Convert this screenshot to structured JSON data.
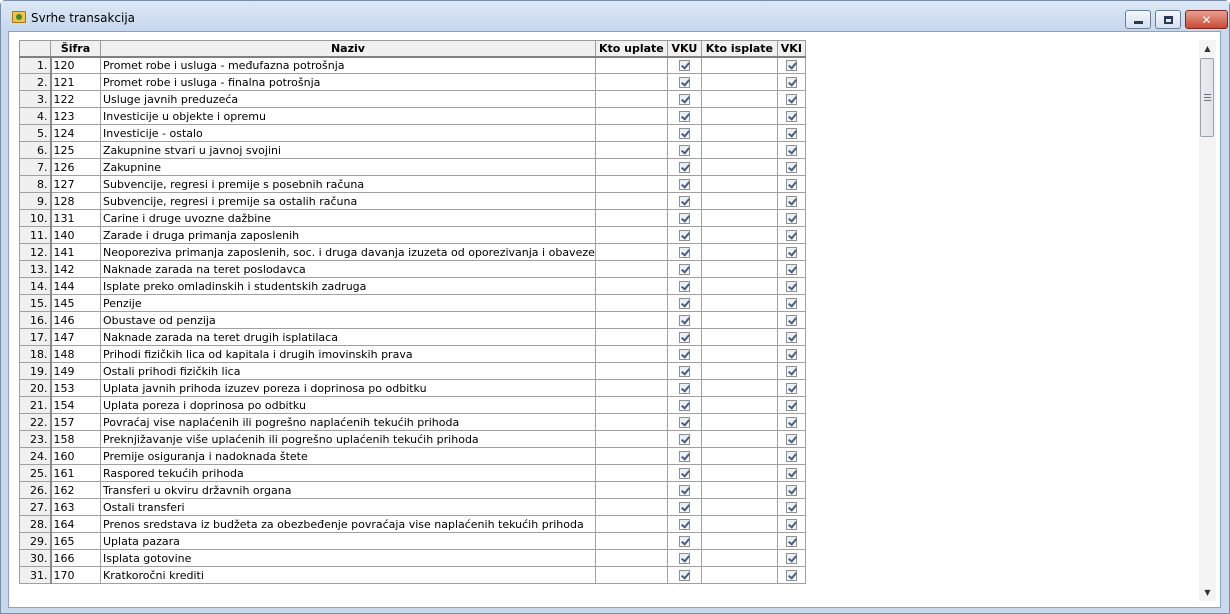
{
  "window": {
    "title": "Svrhe transakcija",
    "icon": "app-window-icon",
    "controls": {
      "minimize": "minimize-icon",
      "maximize": "maximize-icon",
      "close": "✕"
    }
  },
  "table": {
    "columns": {
      "code": "Šifra",
      "name": "Naziv",
      "kto_uplate": "Kto uplate",
      "vku": "VKU",
      "kto_isplate": "Kto isplate",
      "vki": "VKI"
    },
    "rows": [
      {
        "num": "1.",
        "code": "120",
        "name": "Promet robe i usluga - međufazna potrošnja",
        "vku": true,
        "vki": true
      },
      {
        "num": "2.",
        "code": "121",
        "name": "Promet robe i usluga - finalna potrošnja",
        "vku": true,
        "vki": true
      },
      {
        "num": "3.",
        "code": "122",
        "name": "Usluge javnih preduzeća",
        "vku": true,
        "vki": true
      },
      {
        "num": "4.",
        "code": "123",
        "name": "Investicije u objekte i opremu",
        "vku": true,
        "vki": true
      },
      {
        "num": "5.",
        "code": "124",
        "name": "Investicije - ostalo",
        "vku": true,
        "vki": true
      },
      {
        "num": "6.",
        "code": "125",
        "name": "Zakupnine stvari u javnoj svojini",
        "vku": true,
        "vki": true
      },
      {
        "num": "7.",
        "code": "126",
        "name": "Zakupnine",
        "vku": true,
        "vki": true
      },
      {
        "num": "8.",
        "code": "127",
        "name": "Subvencije, regresi i premije s posebnih računa",
        "vku": true,
        "vki": true
      },
      {
        "num": "9.",
        "code": "128",
        "name": "Subvencije, regresi i premije sa ostalih računa",
        "vku": true,
        "vki": true
      },
      {
        "num": "10.",
        "code": "131",
        "name": "Carine i druge uvozne dažbine",
        "vku": true,
        "vki": true
      },
      {
        "num": "11.",
        "code": "140",
        "name": "Zarade i druga primanja zaposlenih",
        "vku": true,
        "vki": true
      },
      {
        "num": "12.",
        "code": "141",
        "name": "Neoporeziva primanja zaposlenih, soc. i druga davanja izuzeta od oporezivanja i obaveze",
        "vku": true,
        "vki": true
      },
      {
        "num": "13.",
        "code": "142",
        "name": "Naknade zarada na teret poslodavca",
        "vku": true,
        "vki": true
      },
      {
        "num": "14.",
        "code": "144",
        "name": "Isplate preko omladinskih i studentskih zadruga",
        "vku": true,
        "vki": true
      },
      {
        "num": "15.",
        "code": "145",
        "name": "Penzije",
        "vku": true,
        "vki": true
      },
      {
        "num": "16.",
        "code": "146",
        "name": "Obustave od penzija",
        "vku": true,
        "vki": true
      },
      {
        "num": "17.",
        "code": "147",
        "name": "Naknade zarada na teret drugih isplatilaca",
        "vku": true,
        "vki": true
      },
      {
        "num": "18.",
        "code": "148",
        "name": "Prihodi fizičkih lica od kapitala i drugih imovinskih prava",
        "vku": true,
        "vki": true
      },
      {
        "num": "19.",
        "code": "149",
        "name": "Ostali prihodi fizičkih lica",
        "vku": true,
        "vki": true
      },
      {
        "num": "20.",
        "code": "153",
        "name": "Uplata javnih prihoda izuzev poreza i doprinosa po odbitku",
        "vku": true,
        "vki": true
      },
      {
        "num": "21.",
        "code": "154",
        "name": "Uplata poreza i doprinosa po odbitku",
        "vku": true,
        "vki": true
      },
      {
        "num": "22.",
        "code": "157",
        "name": "Povraćaj vise naplaćenih ili pogrešno naplaćenih tekućih prihoda",
        "vku": true,
        "vki": true
      },
      {
        "num": "23.",
        "code": "158",
        "name": "Preknjižavanje više uplaćenih ili pogrešno uplaćenih tekućih prihoda",
        "vku": true,
        "vki": true
      },
      {
        "num": "24.",
        "code": "160",
        "name": "Premije osiguranja i nadoknada štete",
        "vku": true,
        "vki": true
      },
      {
        "num": "25.",
        "code": "161",
        "name": "Raspored tekućih prihoda",
        "vku": true,
        "vki": true
      },
      {
        "num": "26.",
        "code": "162",
        "name": "Transferi u okviru državnih organa",
        "vku": true,
        "vki": true
      },
      {
        "num": "27.",
        "code": "163",
        "name": "Ostali transferi",
        "vku": true,
        "vki": true
      },
      {
        "num": "28.",
        "code": "164",
        "name": "Prenos sredstava iz budžeta za obezbeđenje povraćaja vise naplaćenih tekućih prihoda",
        "vku": true,
        "vki": true
      },
      {
        "num": "29.",
        "code": "165",
        "name": "Uplata pazara",
        "vku": true,
        "vki": true
      },
      {
        "num": "30.",
        "code": "166",
        "name": "Isplata gotovine",
        "vku": true,
        "vki": true
      },
      {
        "num": "31.",
        "code": "170",
        "name": "Kratkoročni krediti",
        "vku": true,
        "vki": true
      }
    ]
  },
  "scrollbar": {
    "up": "▲",
    "down": "▼"
  }
}
